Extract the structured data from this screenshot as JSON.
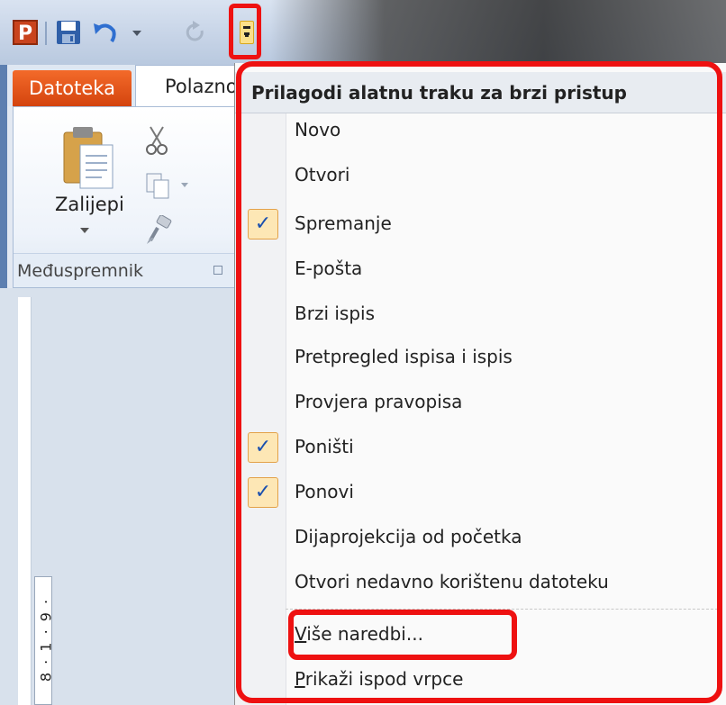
{
  "qat": {
    "app_logo_letter": "P",
    "icons": [
      "powerpoint-logo-icon",
      "save-icon",
      "undo-icon",
      "redo-icon",
      "customize-qat-icon"
    ]
  },
  "tabs": {
    "file": "Datoteka",
    "home": "Polazno"
  },
  "ribbon": {
    "paste_label": "Zalijepi",
    "group_label": "Međuspremnik"
  },
  "ruler": {
    "text": "8 · 1 · 9 ·"
  },
  "menu": {
    "title": "Prilagodi alatnu traku za brzi pristup",
    "items": [
      {
        "label": "Novo",
        "checked": false
      },
      {
        "label": "Otvori",
        "checked": false
      },
      {
        "label": "Spremanje",
        "checked": true
      },
      {
        "label": "E-pošta",
        "checked": false
      },
      {
        "label": "Brzi ispis",
        "checked": false
      },
      {
        "label": "Pretpregled ispisa i ispis",
        "checked": false
      },
      {
        "label": "Provjera pravopisa",
        "checked": false
      },
      {
        "label": "Poništi",
        "checked": true
      },
      {
        "label": "Ponovi",
        "checked": true
      },
      {
        "label": "Dijaprojekcija od početka",
        "checked": false
      },
      {
        "label": "Otvori nedavno korištenu datoteku",
        "checked": false
      }
    ],
    "more_commands": {
      "first": "V",
      "rest": "iše naredbi..."
    },
    "show_below": {
      "first": "P",
      "rest": "rikaži ispod vrpce"
    },
    "check_glyph": "✓"
  },
  "colors": {
    "highlight_outline": "#ee1111",
    "file_tab": "#e1561c",
    "check_bg": "#fde7b5"
  }
}
